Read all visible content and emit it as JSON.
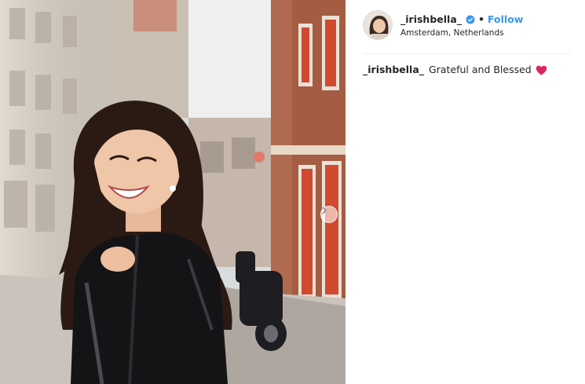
{
  "post": {
    "username": "_irishbella_",
    "separator": "•",
    "follow_label": "Follow",
    "location": "Amsterdam, Netherlands"
  },
  "caption": {
    "username": "_irishbella_",
    "text": "Grateful and Blessed"
  },
  "icons": {
    "verified": "verified-badge-icon",
    "emoji": "red-heart-icon",
    "carousel": "chevron-right-icon"
  },
  "colors": {
    "accent": "#3897f0",
    "heart": "#e0245e",
    "text": "#262626"
  }
}
